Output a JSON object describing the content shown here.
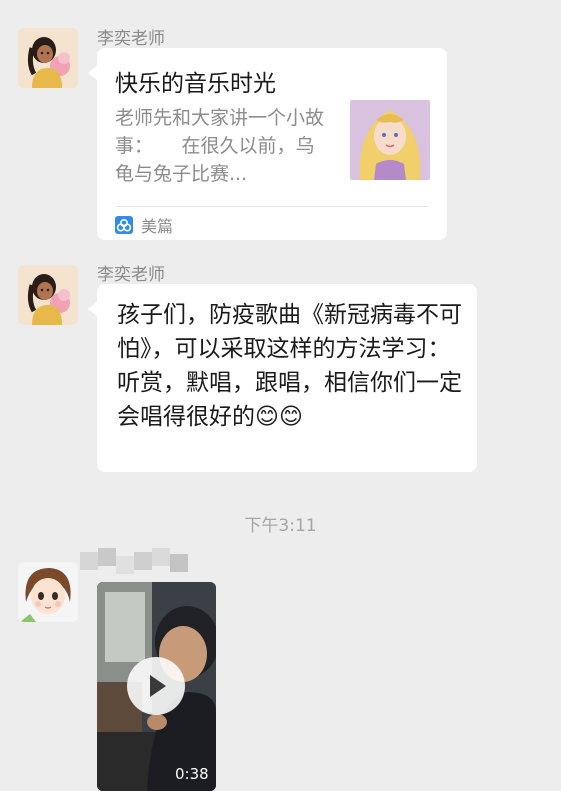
{
  "messages": [
    {
      "sender": "李奕老师",
      "card": {
        "title": "快乐的音乐时光",
        "description": "老师先和大家讲一个小故事：　　在很久以前，乌龟与兔子比赛...",
        "source": "美篇",
        "source_icon": "meipian-logo-icon"
      }
    },
    {
      "sender": "李奕老师",
      "text": "孩子们，防疫歌曲《新冠病毒不可怕》，可以采取这样的方法学习：听赏，默唱，跟唱，相信你们一定会唱得很好的😊😊"
    }
  ],
  "timestamp": "下午3:11",
  "video_message": {
    "duration": "0:38",
    "play_icon": "play-icon"
  },
  "colors": {
    "background": "#ededed",
    "bubble": "#ffffff",
    "meipian_blue": "#2f8ce8"
  }
}
